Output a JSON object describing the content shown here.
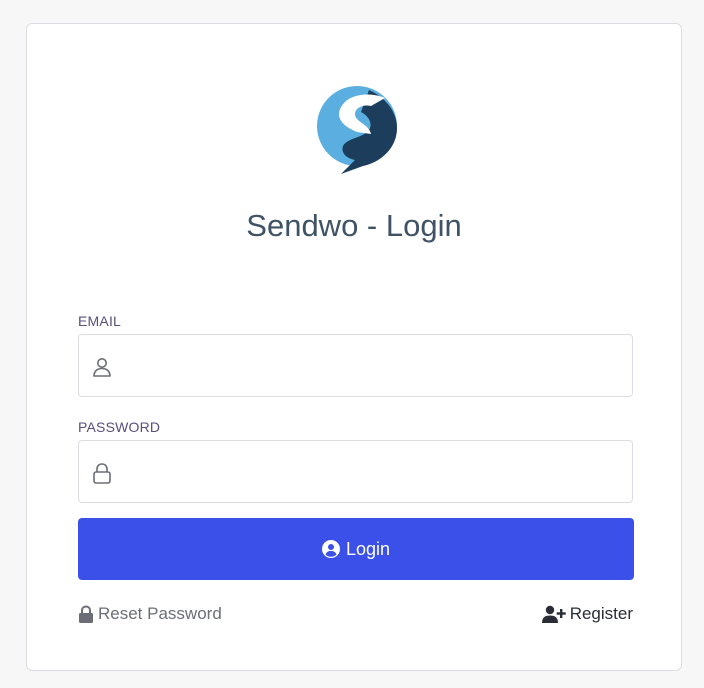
{
  "page": {
    "title": "Sendwo - Login"
  },
  "brand": {
    "logo_icon": "sendwo-s-logo",
    "colors": {
      "light_blue": "#5aaee0",
      "dark_navy": "#1c3d5c"
    }
  },
  "form": {
    "email": {
      "label": "EMAIL",
      "value": "",
      "placeholder": "",
      "icon": "user-icon"
    },
    "password": {
      "label": "PASSWORD",
      "value": "",
      "placeholder": "",
      "icon": "lock-icon"
    },
    "submit": {
      "label": "Login",
      "icon": "user-circle-icon",
      "color": "#3a50e8"
    }
  },
  "links": {
    "reset_password": {
      "label": "Reset Password",
      "icon": "lock-solid-icon"
    },
    "register": {
      "label": "Register",
      "icon": "user-plus-icon"
    }
  }
}
